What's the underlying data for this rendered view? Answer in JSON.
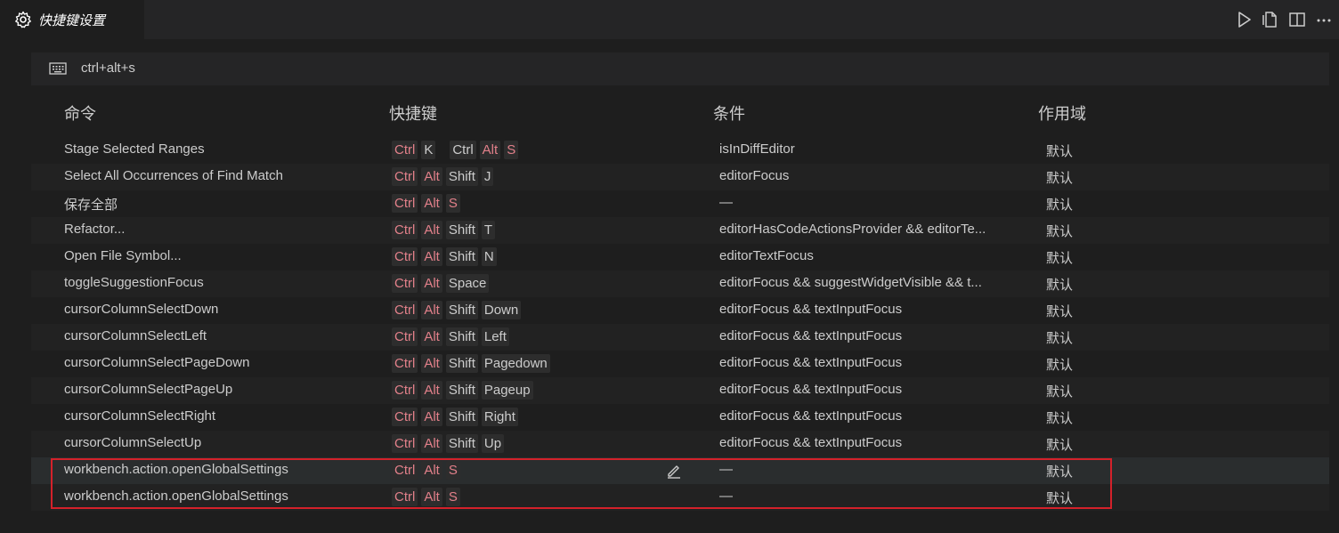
{
  "tab": {
    "title": "快捷键设置",
    "icon": "gear-icon"
  },
  "editor_actions": [
    "run-icon",
    "open-json-icon",
    "split-editor-icon",
    "more-actions-icon"
  ],
  "search": {
    "icon": "keyboard-icon",
    "value": "ctrl+alt+s"
  },
  "columns": {
    "command": "命令",
    "keybinding": "快捷键",
    "when": "条件",
    "source": "作用域"
  },
  "rows": [
    {
      "command": "Stage Selected Ranges",
      "keys": [
        [
          "Ctrl",
          "K"
        ],
        [
          "Ctrl",
          "Alt",
          "S"
        ]
      ],
      "when": "isInDiffEditor",
      "source": "默认"
    },
    {
      "command": "Select All Occurrences of Find Match",
      "keys": [
        [
          "Ctrl",
          "Alt",
          "Shift",
          "J"
        ]
      ],
      "when": "editorFocus",
      "source": "默认"
    },
    {
      "command": "保存全部",
      "keys": [
        [
          "Ctrl",
          "Alt",
          "S"
        ]
      ],
      "when": "—",
      "source": "默认"
    },
    {
      "command": "Refactor...",
      "keys": [
        [
          "Ctrl",
          "Alt",
          "Shift",
          "T"
        ]
      ],
      "when": "editorHasCodeActionsProvider && editorTe...",
      "source": "默认"
    },
    {
      "command": "Open File Symbol...",
      "keys": [
        [
          "Ctrl",
          "Alt",
          "Shift",
          "N"
        ]
      ],
      "when": "editorTextFocus",
      "source": "默认"
    },
    {
      "command": "toggleSuggestionFocus",
      "keys": [
        [
          "Ctrl",
          "Alt",
          "Space"
        ]
      ],
      "when": "editorFocus && suggestWidgetVisible && t...",
      "source": "默认"
    },
    {
      "command": "cursorColumnSelectDown",
      "keys": [
        [
          "Ctrl",
          "Alt",
          "Shift",
          "Down"
        ]
      ],
      "when": "editorFocus && textInputFocus",
      "source": "默认"
    },
    {
      "command": "cursorColumnSelectLeft",
      "keys": [
        [
          "Ctrl",
          "Alt",
          "Shift",
          "Left"
        ]
      ],
      "when": "editorFocus && textInputFocus",
      "source": "默认"
    },
    {
      "command": "cursorColumnSelectPageDown",
      "keys": [
        [
          "Ctrl",
          "Alt",
          "Shift",
          "Pagedown"
        ]
      ],
      "when": "editorFocus && textInputFocus",
      "source": "默认"
    },
    {
      "command": "cursorColumnSelectPageUp",
      "keys": [
        [
          "Ctrl",
          "Alt",
          "Shift",
          "Pageup"
        ]
      ],
      "when": "editorFocus && textInputFocus",
      "source": "默认"
    },
    {
      "command": "cursorColumnSelectRight",
      "keys": [
        [
          "Ctrl",
          "Alt",
          "Shift",
          "Right"
        ]
      ],
      "when": "editorFocus && textInputFocus",
      "source": "默认"
    },
    {
      "command": "cursorColumnSelectUp",
      "keys": [
        [
          "Ctrl",
          "Alt",
          "Shift",
          "Up"
        ]
      ],
      "when": "editorFocus && textInputFocus",
      "source": "默认"
    },
    {
      "command": "workbench.action.openGlobalSettings",
      "keys": [
        [
          "Ctrl",
          "Alt",
          "S"
        ]
      ],
      "when": "—",
      "source": "默认",
      "selected": true
    },
    {
      "command": "workbench.action.openGlobalSettings",
      "keys": [
        [
          "Ctrl",
          "Alt",
          "S"
        ]
      ],
      "when": "—",
      "source": "默认"
    }
  ],
  "colors": {
    "modifier_key": "#e2808a",
    "highlight_border": "#d4212a",
    "background": "#1e1e1e"
  }
}
